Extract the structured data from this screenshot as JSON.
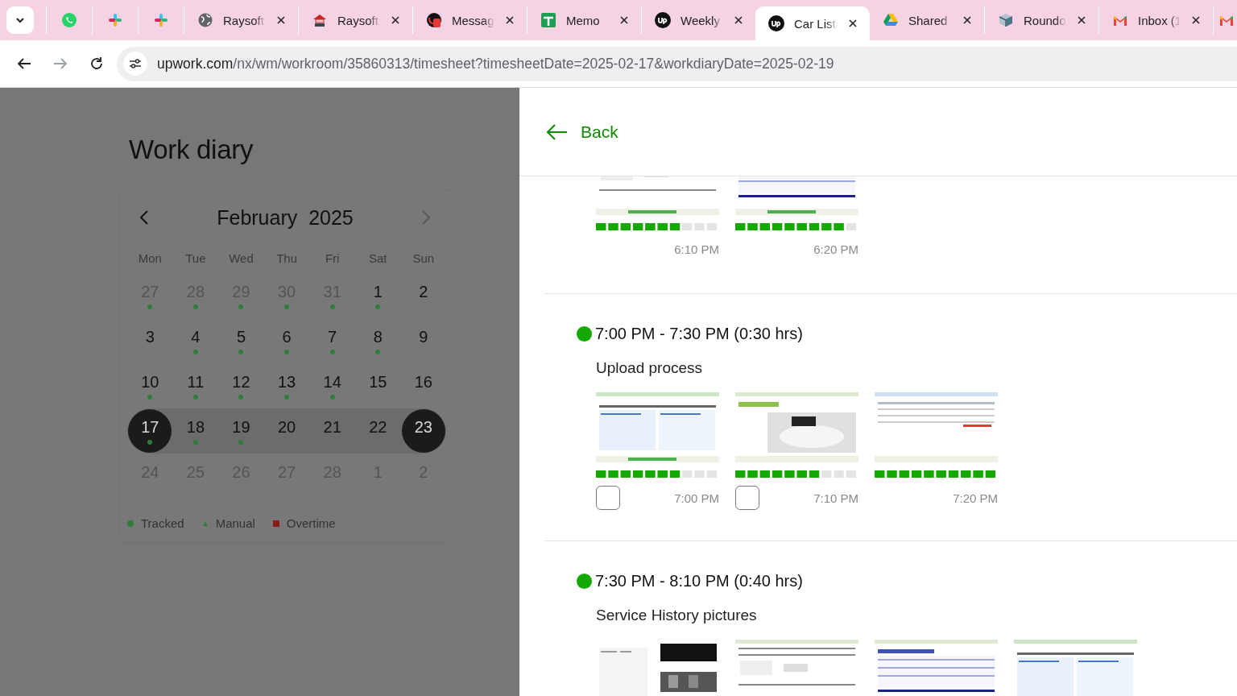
{
  "browser": {
    "tabs": [
      {
        "kind": "pinned",
        "selected": false
      },
      {
        "kind": "pinned",
        "selected": false
      },
      {
        "kind": "pinned",
        "selected": false
      },
      {
        "kind": "titled",
        "title": "Raysoft",
        "selected": false
      },
      {
        "kind": "titled",
        "title": "Raysoft",
        "selected": false
      },
      {
        "kind": "titled",
        "title": "Messag",
        "selected": false
      },
      {
        "kind": "titled",
        "title": "Memo",
        "selected": false
      },
      {
        "kind": "titled",
        "title": "Weekly",
        "selected": false
      },
      {
        "kind": "titled",
        "title": "Car Listi",
        "selected": true
      },
      {
        "kind": "titled",
        "title": "Shared",
        "selected": false
      },
      {
        "kind": "titled",
        "title": "Roundo",
        "selected": false
      },
      {
        "kind": "titled",
        "title": "Inbox (1",
        "selected": false
      },
      {
        "kind": "partial",
        "selected": false
      }
    ],
    "url": {
      "host": "upwork.com",
      "path": "/nx/wm/workroom/35860313/timesheet?timesheetDate=2025-02-17&workdiaryDate=2025-02-19"
    }
  },
  "title": "Work diary",
  "calendar": {
    "month": "February  2025",
    "weekdays": [
      "Mon",
      "Tue",
      "Wed",
      "Thu",
      "Fri",
      "Sat",
      "Sun"
    ],
    "days": [
      {
        "day": "27",
        "muted": true,
        "tracked": true,
        "selected": false,
        "in_range": false
      },
      {
        "day": "28",
        "muted": true,
        "tracked": true,
        "selected": false,
        "in_range": false
      },
      {
        "day": "29",
        "muted": true,
        "tracked": true,
        "selected": false,
        "in_range": false
      },
      {
        "day": "30",
        "muted": true,
        "tracked": true,
        "selected": false,
        "in_range": false
      },
      {
        "day": "31",
        "muted": true,
        "tracked": true,
        "selected": false,
        "in_range": false
      },
      {
        "day": "1",
        "muted": false,
        "tracked": true,
        "selected": false,
        "in_range": false
      },
      {
        "day": "2",
        "muted": false,
        "tracked": false,
        "selected": false,
        "in_range": false
      },
      {
        "day": "3",
        "muted": false,
        "tracked": false,
        "selected": false,
        "in_range": false
      },
      {
        "day": "4",
        "muted": false,
        "tracked": true,
        "selected": false,
        "in_range": false
      },
      {
        "day": "5",
        "muted": false,
        "tracked": true,
        "selected": false,
        "in_range": false
      },
      {
        "day": "6",
        "muted": false,
        "tracked": true,
        "selected": false,
        "in_range": false
      },
      {
        "day": "7",
        "muted": false,
        "tracked": true,
        "selected": false,
        "in_range": false
      },
      {
        "day": "8",
        "muted": false,
        "tracked": true,
        "selected": false,
        "in_range": false
      },
      {
        "day": "9",
        "muted": false,
        "tracked": false,
        "selected": false,
        "in_range": false
      },
      {
        "day": "10",
        "muted": false,
        "tracked": true,
        "selected": false,
        "in_range": false
      },
      {
        "day": "11",
        "muted": false,
        "tracked": true,
        "selected": false,
        "in_range": false
      },
      {
        "day": "12",
        "muted": false,
        "tracked": true,
        "selected": false,
        "in_range": false
      },
      {
        "day": "13",
        "muted": false,
        "tracked": true,
        "selected": false,
        "in_range": false
      },
      {
        "day": "14",
        "muted": false,
        "tracked": true,
        "selected": false,
        "in_range": false
      },
      {
        "day": "15",
        "muted": false,
        "tracked": false,
        "selected": false,
        "in_range": false
      },
      {
        "day": "16",
        "muted": false,
        "tracked": false,
        "selected": false,
        "in_range": false
      },
      {
        "day": "17",
        "muted": false,
        "tracked": true,
        "selected": true,
        "in_range": true
      },
      {
        "day": "18",
        "muted": false,
        "tracked": true,
        "selected": false,
        "in_range": true
      },
      {
        "day": "19",
        "muted": false,
        "tracked": true,
        "selected": false,
        "in_range": true
      },
      {
        "day": "20",
        "muted": false,
        "tracked": false,
        "selected": false,
        "in_range": true
      },
      {
        "day": "21",
        "muted": false,
        "tracked": false,
        "selected": false,
        "in_range": true
      },
      {
        "day": "22",
        "muted": false,
        "tracked": false,
        "selected": false,
        "in_range": true
      },
      {
        "day": "23",
        "muted": false,
        "tracked": false,
        "selected": true,
        "in_range": true
      },
      {
        "day": "24",
        "muted": true,
        "tracked": false,
        "selected": false,
        "in_range": false
      },
      {
        "day": "25",
        "muted": true,
        "tracked": false,
        "selected": false,
        "in_range": false
      },
      {
        "day": "26",
        "muted": true,
        "tracked": false,
        "selected": false,
        "in_range": false
      },
      {
        "day": "27",
        "muted": true,
        "tracked": false,
        "selected": false,
        "in_range": false
      },
      {
        "day": "28",
        "muted": true,
        "tracked": false,
        "selected": false,
        "in_range": false
      },
      {
        "day": "1",
        "muted": true,
        "tracked": false,
        "selected": false,
        "in_range": false
      },
      {
        "day": "2",
        "muted": true,
        "tracked": false,
        "selected": false,
        "in_range": false
      }
    ],
    "legend": [
      {
        "kind": "dot",
        "label": "Tracked",
        "color": "#2e7d3a"
      },
      {
        "kind": "triangle",
        "label": "Manual",
        "color": "#2e7d3a"
      },
      {
        "kind": "square",
        "label": "Overtime",
        "color": "#8b1a1a"
      }
    ]
  },
  "panel": {
    "back": "Back",
    "blocks": [
      {
        "cut": true,
        "shots": [
          {
            "kind": "picture",
            "level": 0.7,
            "time": "6:10 PM"
          },
          {
            "kind": "picture",
            "level": 0.9,
            "time": "6:20 PM"
          }
        ]
      },
      {
        "heading": "7:00 PM - 7:30 PM (0:30 hrs)",
        "memo": "Upload process",
        "shots": [
          {
            "kind": "picture",
            "level": 0.7,
            "checked": false,
            "time": "7:00 PM"
          },
          {
            "kind": "picture",
            "level": 0.7,
            "checked": false,
            "time": "7:10 PM"
          },
          {
            "kind": "picture",
            "level": 1.0,
            "time": "7:20 PM"
          }
        ]
      },
      {
        "heading": "7:30 PM - 8:10 PM (0:40 hrs)",
        "memo": "Service History pictures"
      }
    ]
  }
}
